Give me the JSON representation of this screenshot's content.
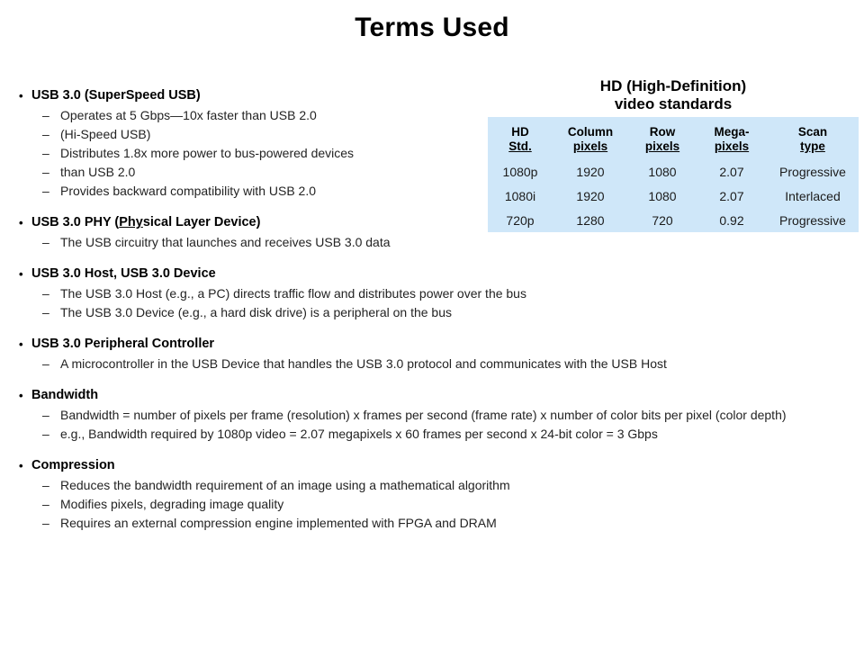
{
  "slide": {
    "title": "Terms Used",
    "bullet_glyph": "•",
    "dash_glyph": "–"
  },
  "groups": [
    {
      "heading": "USB 3.0 (SuperSpeed USB)",
      "items": [
        "Operates at 5 Gbps—10x faster than USB 2.0",
        "(Hi-Speed USB)",
        "Distributes 1.8x more power to bus-powered devices",
        "than USB 2.0",
        "Provides backward compatibility with USB 2.0"
      ]
    },
    {
      "heading_prefix": "USB 3.0 PHY (",
      "heading_underlined": "Phy",
      "heading_suffix": "sical Layer Device)",
      "heading": "USB 3.0 PHY (Physical Layer Device)",
      "items": [
        "The USB circuitry that launches and receives USB 3.0 data"
      ]
    },
    {
      "heading": "USB 3.0 Host, USB 3.0 Device",
      "items": [
        "The USB 3.0 Host (e.g., a PC) directs traffic flow and distributes power over the bus",
        "The USB 3.0 Device (e.g., a hard disk drive) is a peripheral on the bus"
      ]
    },
    {
      "heading": "USB 3.0 Peripheral Controller",
      "items": [
        "A microcontroller in the USB Device that handles the USB 3.0 protocol and communicates with the USB Host"
      ]
    },
    {
      "heading": "Bandwidth",
      "items": [
        "Bandwidth = number of pixels per frame (resolution) x frames per second (frame rate) x number of color bits per pixel (color depth)",
        "e.g., Bandwidth required by 1080p video = 2.07 megapixels x 60 frames per second x 24-bit color = 3 Gbps"
      ]
    },
    {
      "heading": "Compression",
      "items": [
        "Reduces the bandwidth requirement of an image using a mathematical algorithm",
        "Modifies pixels, degrading image quality",
        "Requires an external compression engine implemented with FPGA and DRAM"
      ]
    }
  ],
  "hd_table": {
    "title_line1": "HD (High-Definition)",
    "title_line2": "video standards",
    "background": "#cfe7f9",
    "headers": [
      {
        "line1": "HD",
        "line2": "Std."
      },
      {
        "line1": "Column",
        "line2": "pixels"
      },
      {
        "line1": "Row",
        "line2": "pixels"
      },
      {
        "line1": "Mega-",
        "line2": "pixels"
      },
      {
        "line1": "Scan",
        "line2": "type"
      }
    ],
    "rows": [
      [
        "1080p",
        "1920",
        "1080",
        "2.07",
        "Progressive"
      ],
      [
        "1080i",
        "1920",
        "1080",
        "2.07",
        "Interlaced"
      ],
      [
        "720p",
        "1280",
        "720",
        "0.92",
        "Progressive"
      ]
    ]
  }
}
